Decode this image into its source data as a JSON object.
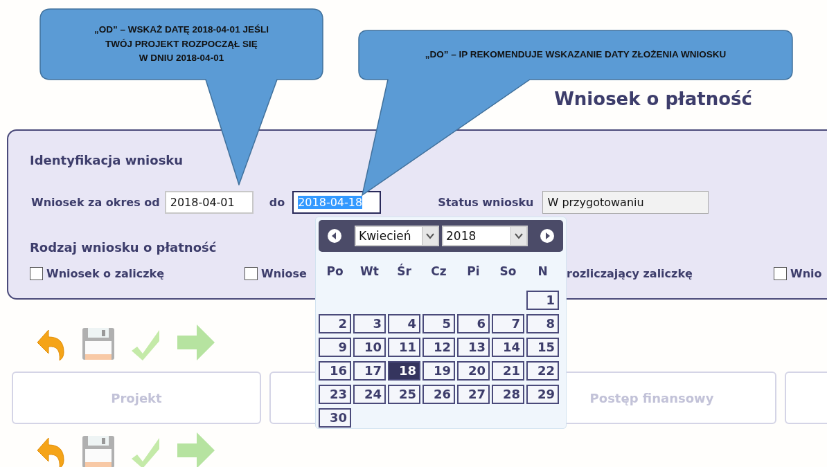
{
  "callouts": [
    {
      "lines": [
        "„OD” – WSKAŻ DATĘ 2018-04-01 JEŚLI",
        "TWÓJ PROJEKT ROZPOCZĄŁ SIĘ",
        "W DNIU 2018-04-01"
      ]
    },
    {
      "lines": [
        "„DO” – IP REKOMENDUJE WSKAZANIE DATY ZŁOŻENIA WNIOSKU"
      ]
    }
  ],
  "page_title": "Wniosek o płatność",
  "identification": {
    "heading": "Identyfikacja wniosku",
    "period_label": "Wniosek za okres od",
    "date_from": {
      "value": "2018-04-01",
      "focused": false
    },
    "to_label": "do",
    "date_to": {
      "value": "2018-04-18",
      "focused": true
    },
    "status_label": "Status wniosku",
    "status_value": "W przygotowaniu",
    "type_heading": "Rodzaj wniosku o płatność",
    "types": [
      {
        "kind": "checkbox",
        "label": "Wniosek o zaliczkę",
        "checked": false
      },
      {
        "kind": "checkbox",
        "label": "Wniose",
        "checked": false
      },
      {
        "kind": "text",
        "label": "rozliczający zaliczkę"
      },
      {
        "kind": "checkbox",
        "label": "Wnio",
        "checked": false
      }
    ]
  },
  "calendar": {
    "month": "Kwiecień",
    "year": "2018",
    "weekdays": [
      "Po",
      "Wt",
      "Śr",
      "Cz",
      "Pi",
      "So",
      "N"
    ],
    "weeks": [
      [
        {
          "kind": "empty"
        },
        {
          "kind": "empty"
        },
        {
          "kind": "empty"
        },
        {
          "kind": "empty"
        },
        {
          "kind": "empty"
        },
        {
          "kind": "empty"
        },
        {
          "label": "1",
          "selected": false
        }
      ],
      [
        {
          "label": "2",
          "selected": false
        },
        {
          "label": "3",
          "selected": false
        },
        {
          "label": "4",
          "selected": false
        },
        {
          "label": "5",
          "selected": false
        },
        {
          "label": "6",
          "selected": false
        },
        {
          "label": "7",
          "selected": false
        },
        {
          "label": "8",
          "selected": false
        }
      ],
      [
        {
          "label": "9",
          "selected": false
        },
        {
          "label": "10",
          "selected": false
        },
        {
          "label": "11",
          "selected": false
        },
        {
          "label": "12",
          "selected": false
        },
        {
          "label": "13",
          "selected": false
        },
        {
          "label": "14",
          "selected": false
        },
        {
          "label": "15",
          "selected": false
        }
      ],
      [
        {
          "label": "16",
          "selected": false
        },
        {
          "label": "17",
          "selected": false
        },
        {
          "label": "18",
          "selected": true
        },
        {
          "label": "19",
          "selected": false
        },
        {
          "label": "20",
          "selected": false
        },
        {
          "label": "21",
          "selected": false
        },
        {
          "label": "22",
          "selected": false
        }
      ],
      [
        {
          "label": "23",
          "selected": false
        },
        {
          "label": "24",
          "selected": false
        },
        {
          "label": "25",
          "selected": false
        },
        {
          "label": "26",
          "selected": false
        },
        {
          "label": "27",
          "selected": false
        },
        {
          "label": "28",
          "selected": false
        },
        {
          "label": "29",
          "selected": false
        }
      ],
      [
        {
          "label": "30",
          "selected": false
        }
      ]
    ]
  },
  "sections": [
    {
      "kind": "labelled",
      "label": "Projekt"
    },
    {
      "kind": "covered"
    },
    {
      "kind": "labelled",
      "label": "Postęp finansowy"
    },
    {
      "kind": "covered"
    }
  ]
}
